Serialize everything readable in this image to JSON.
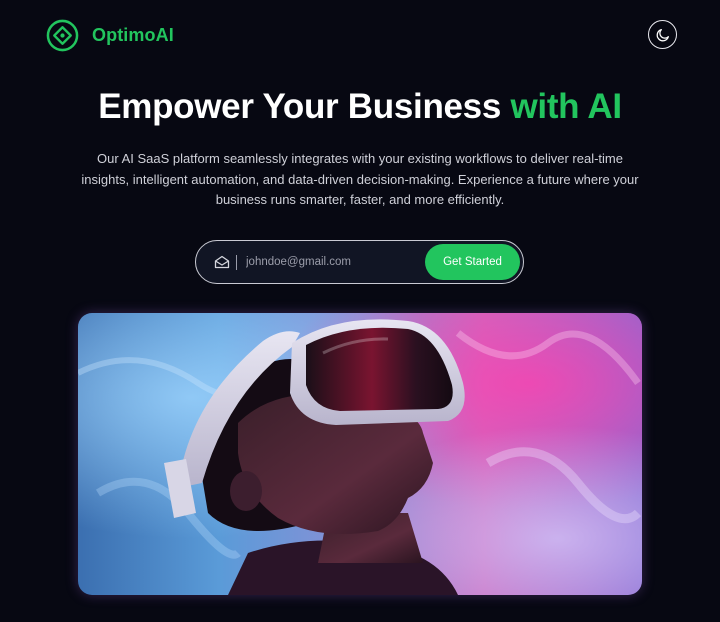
{
  "header": {
    "brand_name": "OptimoAI",
    "logo_icon": "diamond-circle-logo",
    "theme_toggle_icon": "moon-icon"
  },
  "hero": {
    "headline_main": "Empower Your Business",
    "headline_accent": "with AI",
    "description": "Our AI SaaS platform seamlessly integrates with your existing workflows to deliver real-time insights, intelligent automation, and data-driven decision-making. Experience a future where your business runs smarter, faster, and more efficiently."
  },
  "signup": {
    "email_icon": "mail-open-icon",
    "email_placeholder": "johndoe@gmail.com",
    "email_value": "",
    "button_label": "Get Started"
  },
  "image": {
    "alt": "Person wearing a VR headset against an iridescent blue and pink background"
  },
  "colors": {
    "accent": "#22c55e",
    "background": "#070812",
    "text": "#ffffff",
    "muted_text": "#cfd0d8"
  }
}
